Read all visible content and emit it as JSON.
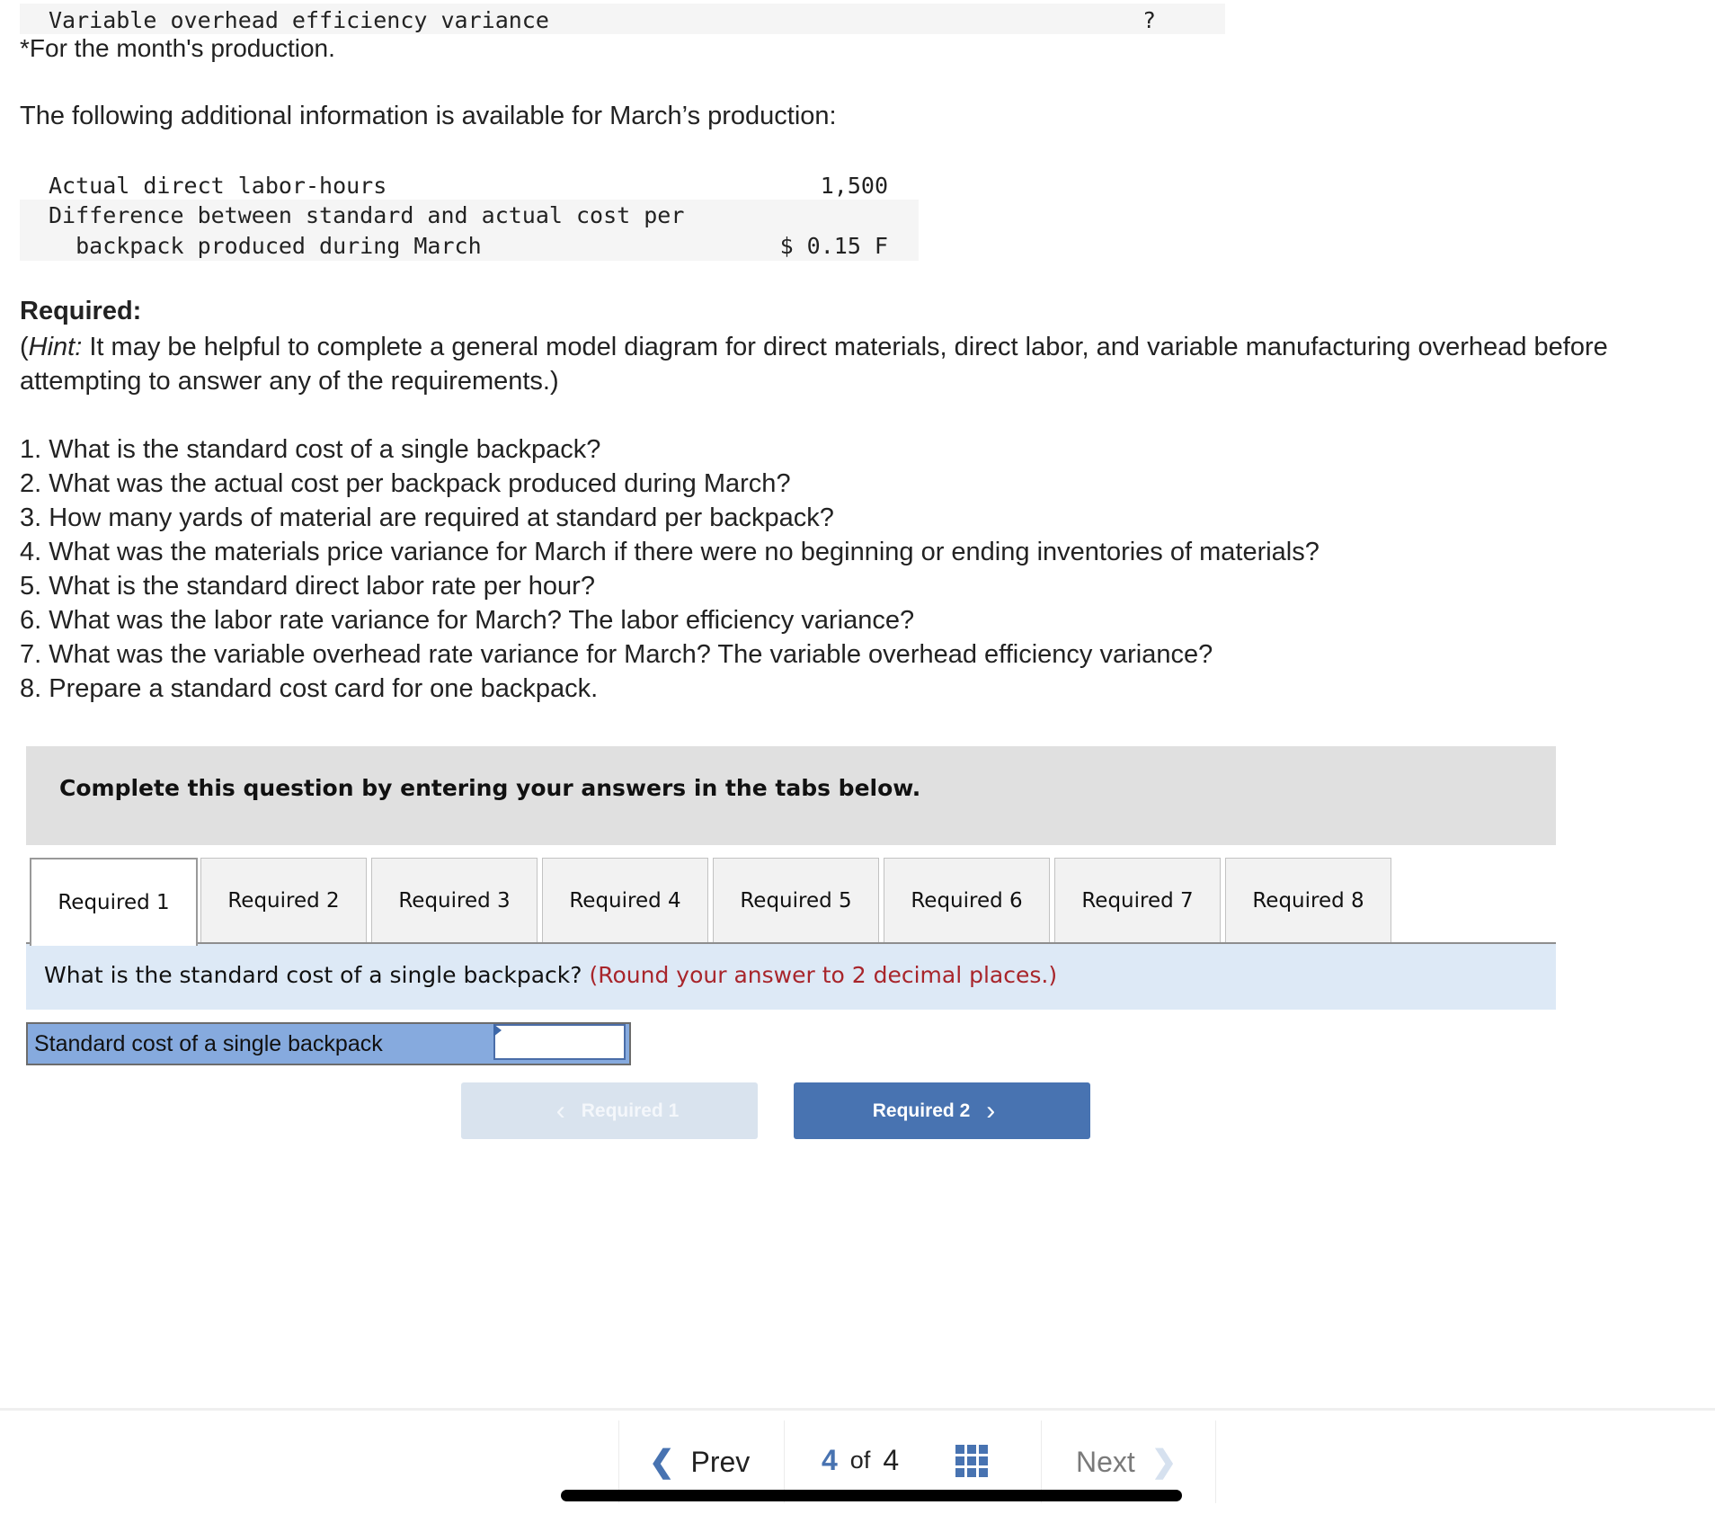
{
  "top_table": {
    "row_label": "Variable overhead efficiency variance",
    "row_value": "?"
  },
  "footnote": "*For the month's production.",
  "intro": "The following additional information is available for March’s production:",
  "info_table": {
    "rows": [
      {
        "label": "Actual direct labor-hours",
        "value": "1,500"
      },
      {
        "label": "Difference between standard and actual cost per",
        "label_line2": "  backpack produced during March",
        "value": "$ 0.15 F"
      }
    ]
  },
  "required": {
    "heading": "Required:",
    "hint_label": "Hint:",
    "hint_open": "(",
    "hint_text": " It may be helpful to complete a general model diagram for direct materials, direct labor, and variable manufacturing overhead before attempting to answer any of the requirements.)",
    "questions": [
      "1. What is the standard cost of a single backpack?",
      "2. What was the actual cost per backpack produced during March?",
      "3. How many yards of material are required at standard per backpack?",
      "4. What was the materials price variance for March if there were no beginning or ending inventories of materials?",
      "5. What is the standard direct labor rate per hour?",
      "6. What was the labor rate variance for March? The labor efficiency variance?",
      "7. What was the variable overhead rate variance for March? The variable overhead efficiency variance?",
      "8. Prepare a standard cost card for one backpack."
    ]
  },
  "banner": "Complete this question by entering your answers in the tabs below.",
  "tabs": [
    {
      "label": "Required 1",
      "active": true
    },
    {
      "label": "Required 2",
      "active": false
    },
    {
      "label": "Required 3",
      "active": false
    },
    {
      "label": "Required 4",
      "active": false
    },
    {
      "label": "Required 5",
      "active": false
    },
    {
      "label": "Required 6",
      "active": false
    },
    {
      "label": "Required 7",
      "active": false
    },
    {
      "label": "Required 8",
      "active": false
    }
  ],
  "question_band": {
    "question": "What is the standard cost of a single backpack?",
    "note": "(Round your answer to 2 decimal places.)"
  },
  "answer": {
    "label": "Standard cost of a single backpack",
    "value": "",
    "placeholder": ""
  },
  "nav_buttons": {
    "prev_label": "Required 1",
    "prev_icon": "chevron-left-icon",
    "next_label": "Required 2",
    "next_icon": "chevron-right-icon",
    "prev_disabled": true
  },
  "footer": {
    "prev_label": "Prev",
    "current_page": "4",
    "of_label": "of",
    "total_pages": "4",
    "next_label": "Next",
    "grid_icon": "grid-icon",
    "colors": {
      "accent": "#4873b1",
      "next_disabled": "#7a7a7a"
    }
  },
  "colors": {
    "banner_bg": "#e0e0e0",
    "question_band_bg": "#dde9f6",
    "note_red": "#a8252b",
    "answer_label_bg": "#86aade",
    "next_button_bg": "#4873b1",
    "prev_button_bg": "#d9e3ee"
  }
}
